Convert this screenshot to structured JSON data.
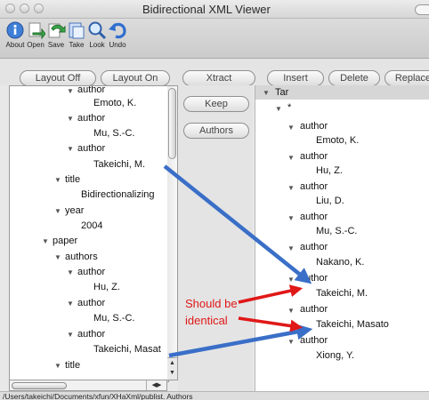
{
  "window": {
    "title": "Bidirectional XML Viewer"
  },
  "toolbar": {
    "items": [
      {
        "label": "About",
        "icon": "info-icon"
      },
      {
        "label": "Open",
        "icon": "open-icon"
      },
      {
        "label": "Save",
        "icon": "save-icon"
      },
      {
        "label": "Take",
        "icon": "take-icon"
      },
      {
        "label": "Look",
        "icon": "look-icon"
      },
      {
        "label": "Undo",
        "icon": "undo-icon"
      }
    ]
  },
  "buttons": {
    "layout_off": "Layout Off",
    "layout_on": "Layout On",
    "xtract": "Xtract",
    "keep": "Keep",
    "authors": "Authors",
    "insert": "Insert",
    "delete": "Delete",
    "replace": "Replace"
  },
  "left_tree": [
    {
      "text": "author",
      "expanded": true
    },
    {
      "text": "Emoto, K."
    },
    {
      "text": "author",
      "expanded": true
    },
    {
      "text": "Mu, S.-C."
    },
    {
      "text": "author",
      "expanded": true
    },
    {
      "text": "Takeichi, M."
    },
    {
      "text": "title",
      "expanded": true
    },
    {
      "text": "Bidirectionalizing"
    },
    {
      "text": "year",
      "expanded": true
    },
    {
      "text": "2004"
    },
    {
      "text": "paper",
      "expanded": true
    },
    {
      "text": "authors",
      "expanded": true
    },
    {
      "text": "author",
      "expanded": true
    },
    {
      "text": "Hu, Z."
    },
    {
      "text": "author",
      "expanded": true
    },
    {
      "text": "Mu, S.-C."
    },
    {
      "text": "author",
      "expanded": true
    },
    {
      "text": "Takeichi, Masat"
    },
    {
      "text": "title",
      "expanded": true
    }
  ],
  "right_tree": [
    {
      "text": "Tar",
      "expanded": true
    },
    {
      "text": "*",
      "expanded": true
    },
    {
      "text": "author",
      "expanded": true
    },
    {
      "text": "Emoto, K."
    },
    {
      "text": "author",
      "expanded": true
    },
    {
      "text": "Hu, Z."
    },
    {
      "text": "author",
      "expanded": true
    },
    {
      "text": "Liu, D."
    },
    {
      "text": "author",
      "expanded": true
    },
    {
      "text": "Mu, S.-C."
    },
    {
      "text": "author",
      "expanded": true
    },
    {
      "text": "Nakano, K."
    },
    {
      "text": "author",
      "expanded": true
    },
    {
      "text": "Takeichi, M."
    },
    {
      "text": "author",
      "expanded": true
    },
    {
      "text": "Takeichi, Masato"
    },
    {
      "text": "author",
      "expanded": true
    },
    {
      "text": "Xiong, Y."
    }
  ],
  "annotation": {
    "line1": "Should be",
    "line2": "identical",
    "color": "#e01818"
  },
  "arrow_color": "#3a6fc8",
  "status": {
    "text": "/Users/takeichi/Documents/xfun/XHaXml/publist. Authors"
  },
  "colors": {
    "accent": "#3a6fc8",
    "annotation": "#e01818"
  }
}
